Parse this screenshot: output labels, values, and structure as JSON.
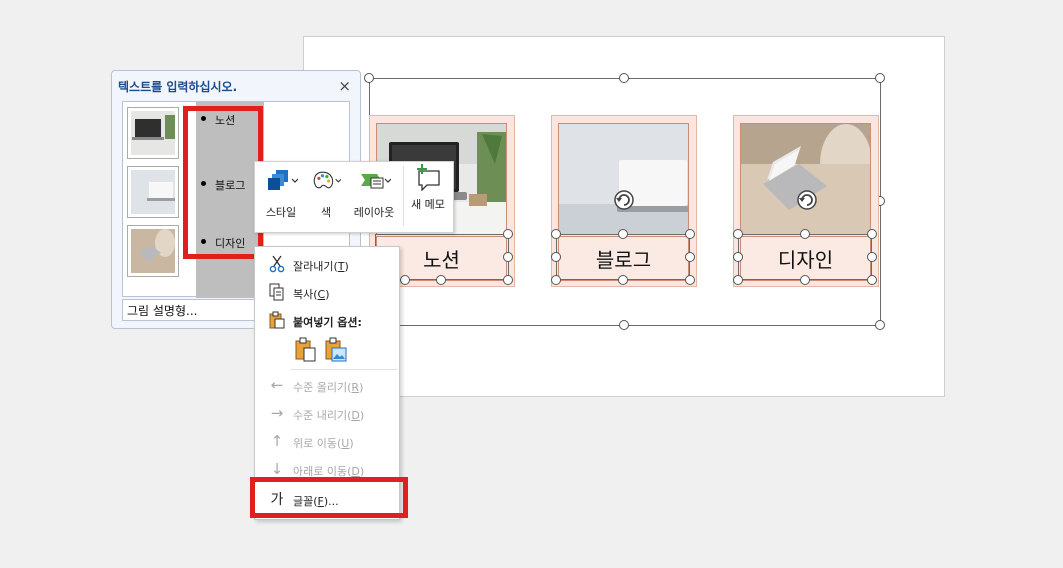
{
  "slide": {
    "cards": [
      {
        "label": "노션"
      },
      {
        "label": "블로그"
      },
      {
        "label": "디자인"
      }
    ]
  },
  "text_pane": {
    "title": "텍스트를 입력하십시오.",
    "close_icon": "×",
    "bullets": [
      "노션",
      "블로그",
      "디자인"
    ],
    "layout_name": "그림 설명형..."
  },
  "mini_toolbar": {
    "style_label": "스타일",
    "color_label": "색",
    "layout_label": "레이아웃",
    "memo_label": "새 메모"
  },
  "context_menu": {
    "items": [
      {
        "label": "잘라내기",
        "key": "T",
        "icon": "scissors-icon"
      },
      {
        "label": "복사",
        "key": "C",
        "icon": "copy-icon"
      },
      {
        "label": "붙여넣기 옵션:",
        "icon": "paste-icon"
      },
      {
        "label": "수준 올리기",
        "key": "R",
        "icon": "arrow-left-icon"
      },
      {
        "label": "수준 내리기",
        "key": "D",
        "icon": "arrow-right-icon"
      },
      {
        "label": "위로 이동",
        "key": "U",
        "icon": "arrow-up-icon"
      },
      {
        "label": "아래로 이동",
        "key": "D",
        "icon": "arrow-down-icon"
      },
      {
        "label": "글꼴",
        "key": "F",
        "suffix": "...",
        "icon_text": "가"
      }
    ]
  },
  "colors": {
    "highlight": "#e0201f",
    "card_fill": "#fbe6df",
    "pane_title": "#1d4b8f"
  }
}
